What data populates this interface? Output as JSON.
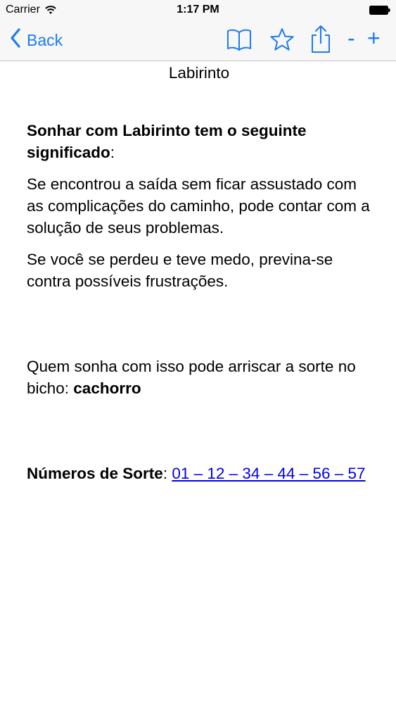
{
  "status_bar": {
    "carrier": "Carrier",
    "time": "1:17 PM"
  },
  "nav": {
    "back_label": "Back",
    "icons": [
      "book-icon",
      "star-icon",
      "share-icon"
    ],
    "zoom_out_label": "-",
    "zoom_in_label": "+",
    "accent_color": "#1a7cf5"
  },
  "article": {
    "title": "Labirinto",
    "meaning_heading": "Sonhar com Labirinto tem o seguinte significado",
    "meaning_colon": ":",
    "paragraph_1": "Se encontrou a saída sem ficar assustado com as complicações do caminho, pode contar com a solução de seus problemas.",
    "paragraph_2": "Se você se perdeu e teve medo, previna-se contra possíveis frustrações.",
    "bicho_text": "Quem sonha com isso pode arriscar a sorte no bicho: ",
    "bicho_animal": "cachorro",
    "lucky_label": "Números de Sorte",
    "lucky_colon": ": ",
    "lucky_numbers": "01 – 12 – 34 – 44 – 56 – 57"
  }
}
